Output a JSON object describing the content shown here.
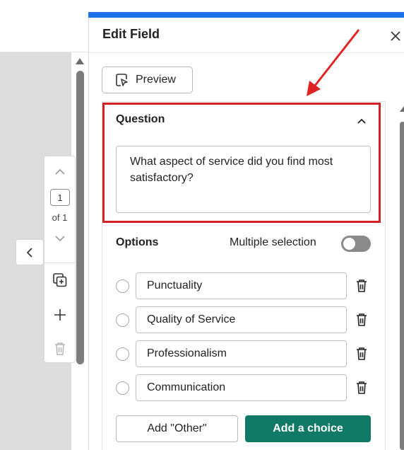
{
  "panel": {
    "title": "Edit Field",
    "preview_label": "Preview"
  },
  "page_nav": {
    "current_page": "1",
    "of_label": "of 1"
  },
  "question": {
    "label": "Question",
    "text": "What aspect of service did you find most satisfactory?"
  },
  "options": {
    "label": "Options",
    "multiple_selection_label": "Multiple selection",
    "multiple_selection_enabled": false,
    "items": [
      {
        "label": "Punctuality"
      },
      {
        "label": "Quality of Service"
      },
      {
        "label": "Professionalism"
      },
      {
        "label": "Communication"
      }
    ]
  },
  "actions": {
    "add_other_label": "Add \"Other\"",
    "add_choice_label": "Add a choice"
  },
  "colors": {
    "accent_blue": "#1a73e8",
    "highlight_red": "#d32128",
    "primary_green": "#117a66"
  }
}
